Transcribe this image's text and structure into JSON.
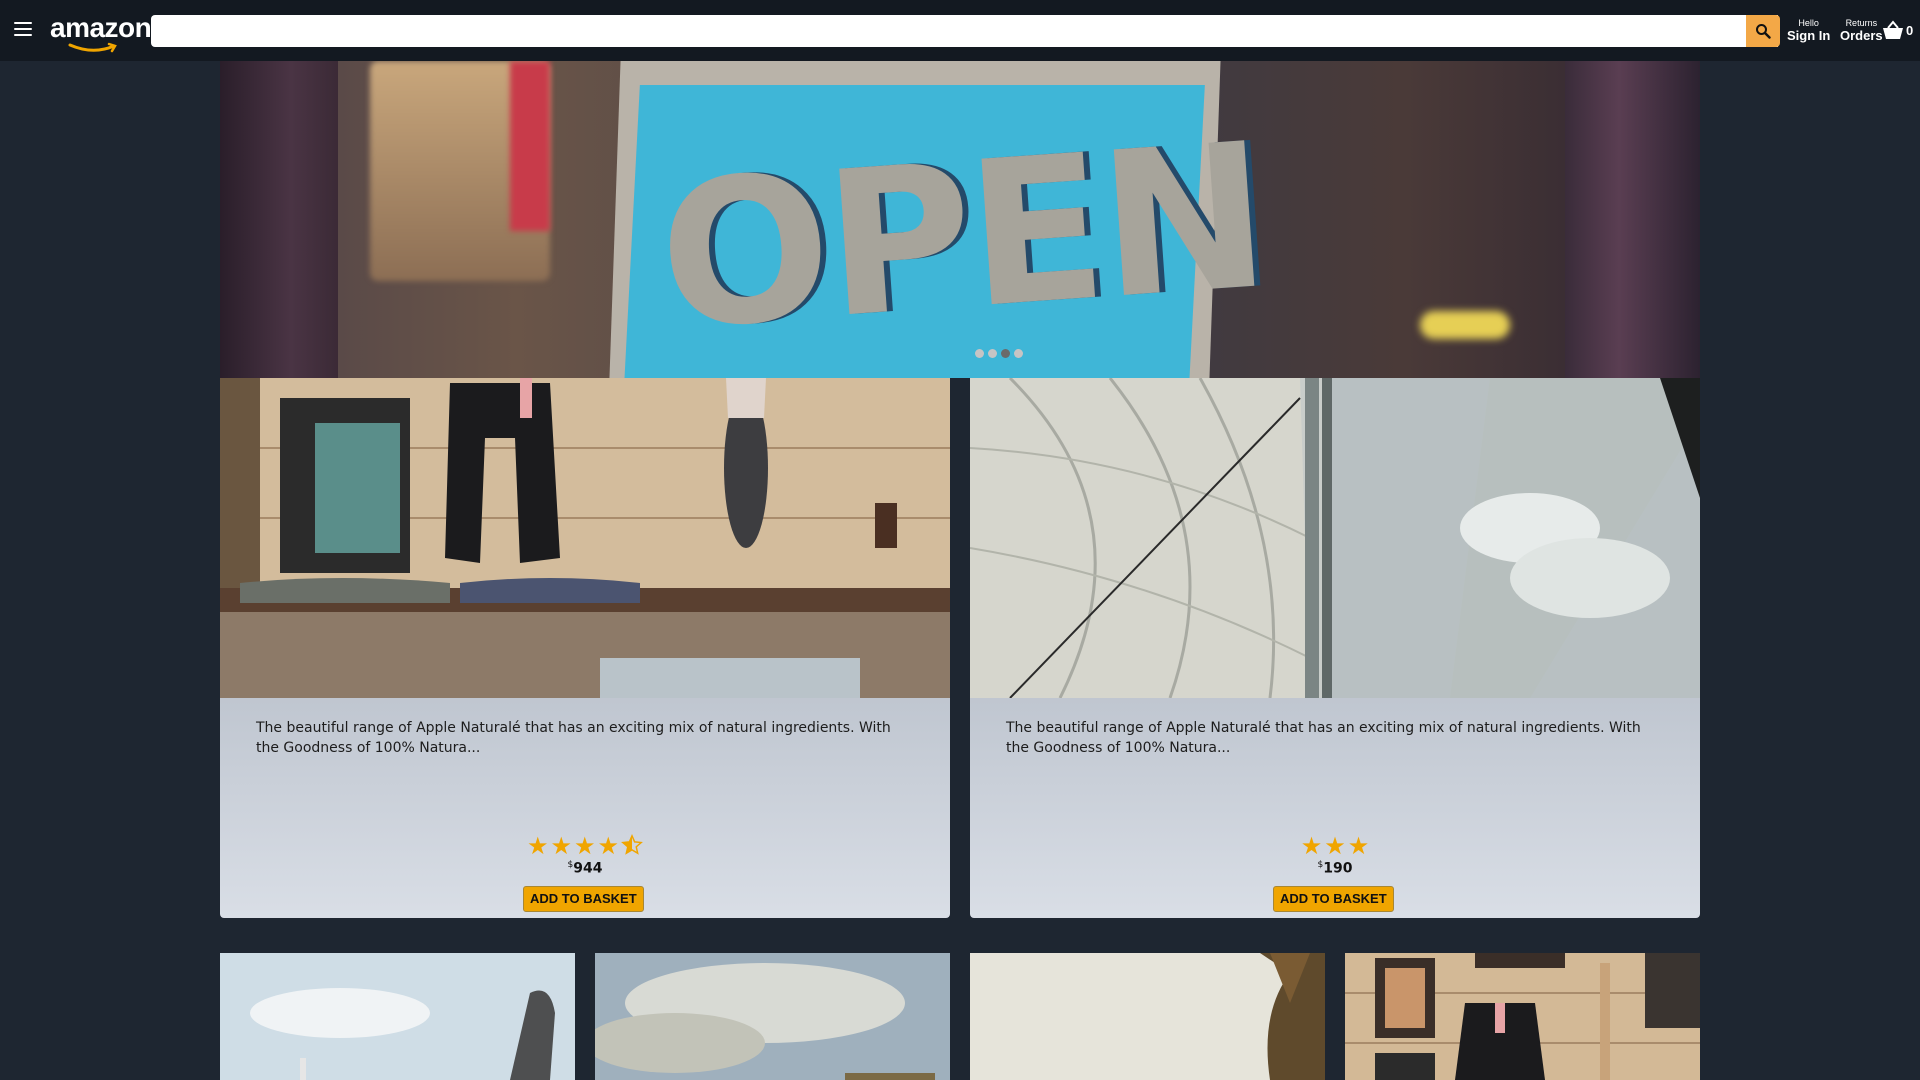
{
  "header": {
    "logo": "amazon",
    "search": {
      "placeholder": "",
      "value": ""
    },
    "signin": {
      "line1": "Hello",
      "line2": "Sign In"
    },
    "orders": {
      "line1": "Returns",
      "line2": "Orders"
    },
    "basket_count": "0"
  },
  "hero": {
    "sign_text": "OPEN",
    "dots": 4,
    "active_dot": 3
  },
  "products": [
    {
      "description": "The beautiful range of Apple Naturalé that has an exciting mix of natural ingredients. With the Goodness of 100% Natura...",
      "rating": 4.5,
      "currency": "$",
      "price": "944",
      "button": "ADD TO BASKET"
    },
    {
      "description": "The beautiful range of Apple Naturalé that has an exciting mix of natural ingredients. With the Goodness of 100% Natura...",
      "rating": 3,
      "currency": "$",
      "price": "190",
      "button": "ADD TO BASKET"
    }
  ],
  "colors": {
    "header_bg": "#131921",
    "page_bg": "#1e2631",
    "accent": "#f0a500",
    "search_button": "#f3a847"
  }
}
